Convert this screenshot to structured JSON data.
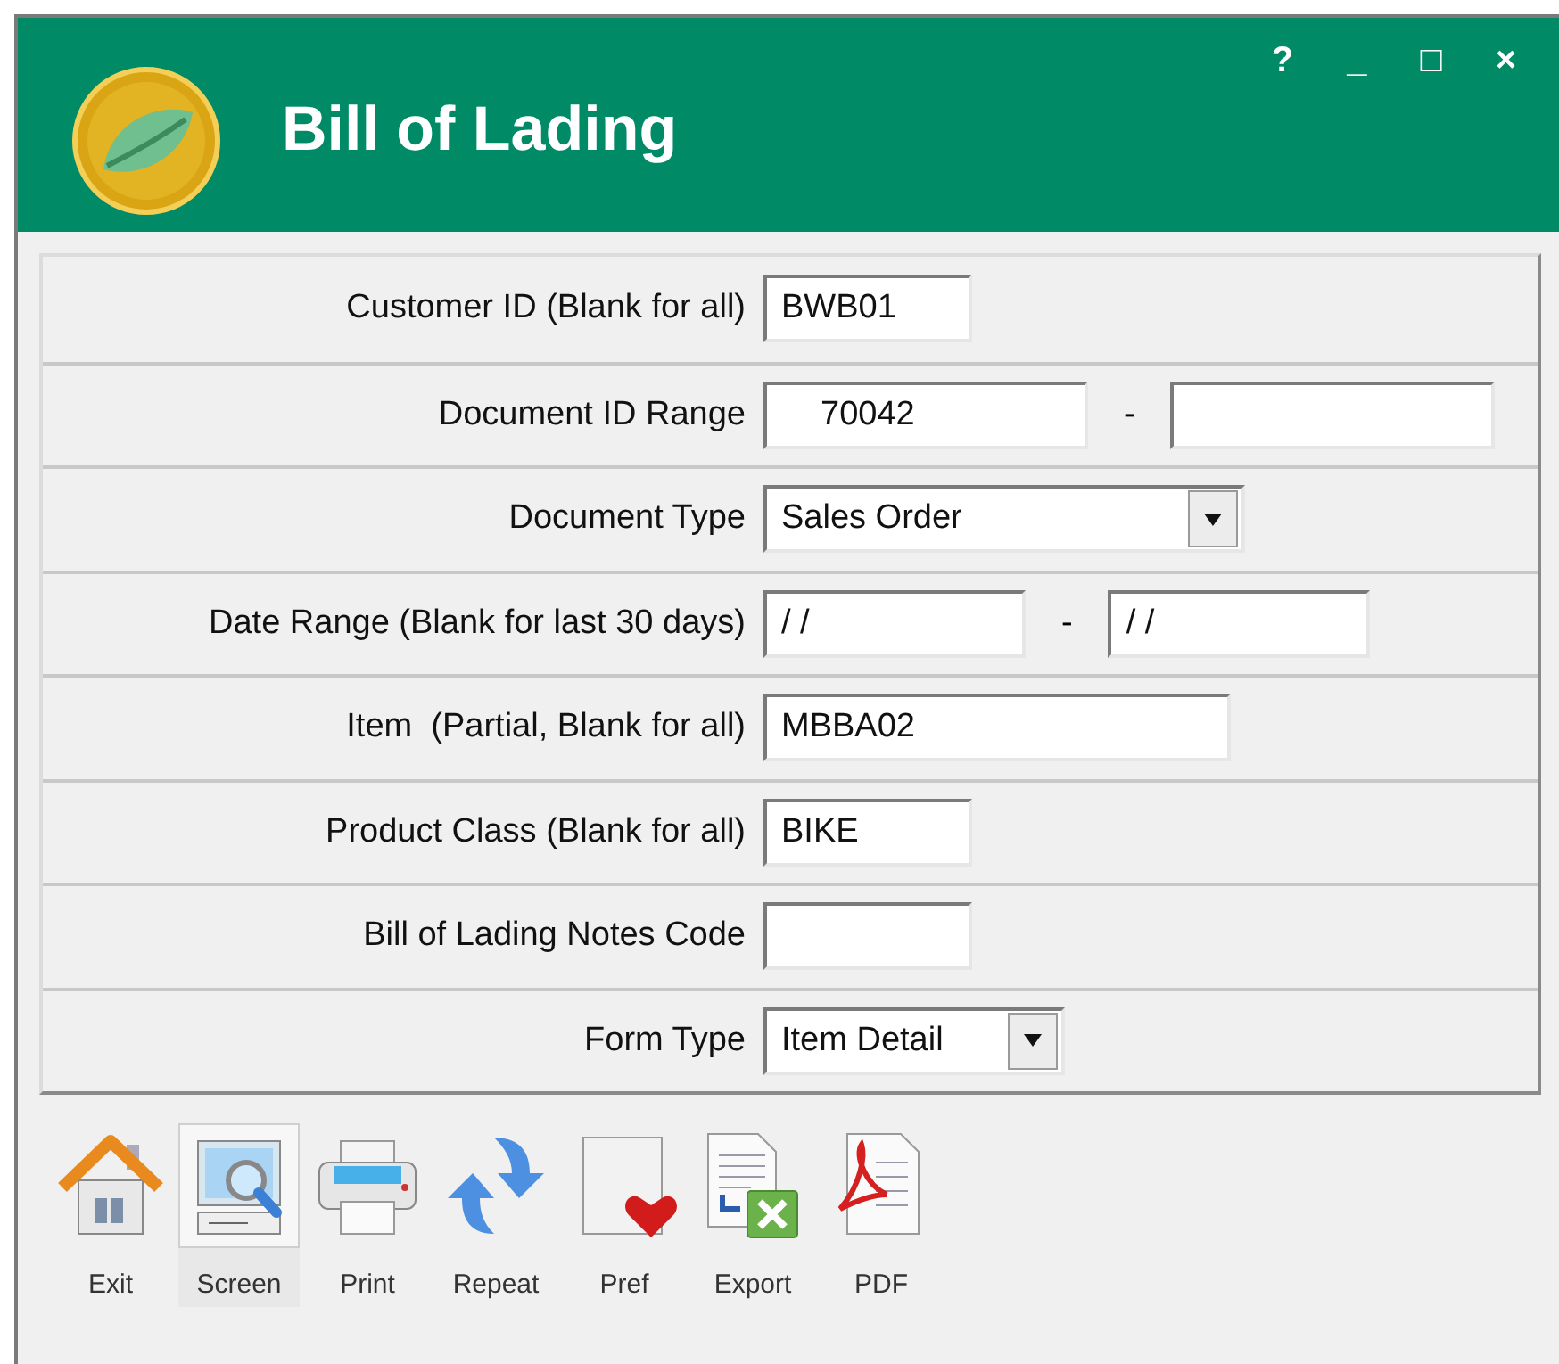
{
  "window": {
    "title": "Bill of Lading",
    "controls": [
      "?",
      "_",
      "□",
      "×"
    ]
  },
  "form": {
    "rows": [
      {
        "label": "Customer ID (Blank for all)",
        "fields": [
          {
            "kind": "text",
            "value": "BWB01"
          }
        ]
      },
      {
        "label": "Document ID Range",
        "fields": [
          {
            "kind": "text",
            "value": "70042"
          },
          {
            "kind": "text"
          }
        ],
        "separator": "-"
      },
      {
        "label": "Document Type",
        "fields": [
          {
            "kind": "select",
            "value": "Sales Order"
          }
        ]
      },
      {
        "label": "Date Range (Blank for last 30 days)",
        "fields": [
          {
            "kind": "text",
            "value": "/ /"
          },
          {
            "kind": "text",
            "value": "/ /"
          }
        ],
        "separator": "-"
      },
      {
        "label": "Item  (Partial, Blank for all)",
        "fields": [
          {
            "kind": "text",
            "value": "MBBA02"
          }
        ]
      },
      {
        "label": "Product Class (Blank for all)",
        "fields": [
          {
            "kind": "text",
            "value": "BIKE"
          }
        ]
      },
      {
        "label": "Bill of Lading Notes Code",
        "fields": [
          {
            "kind": "text"
          }
        ]
      },
      {
        "label": "Form Type",
        "fields": [
          {
            "kind": "select",
            "value": "Item Detail"
          }
        ]
      }
    ]
  },
  "toolbar": [
    {
      "label": "Exit",
      "kind": "home",
      "selected": false
    },
    {
      "label": "Screen",
      "kind": "screen",
      "selected": true
    },
    {
      "label": "Print",
      "kind": "printer",
      "selected": false
    },
    {
      "label": "Repeat",
      "kind": "repeat",
      "selected": false
    },
    {
      "label": "Pref",
      "kind": "heart",
      "selected": false
    },
    {
      "label": "Export",
      "kind": "export",
      "selected": false
    },
    {
      "label": "PDF",
      "kind": "pdf",
      "selected": false
    }
  ]
}
